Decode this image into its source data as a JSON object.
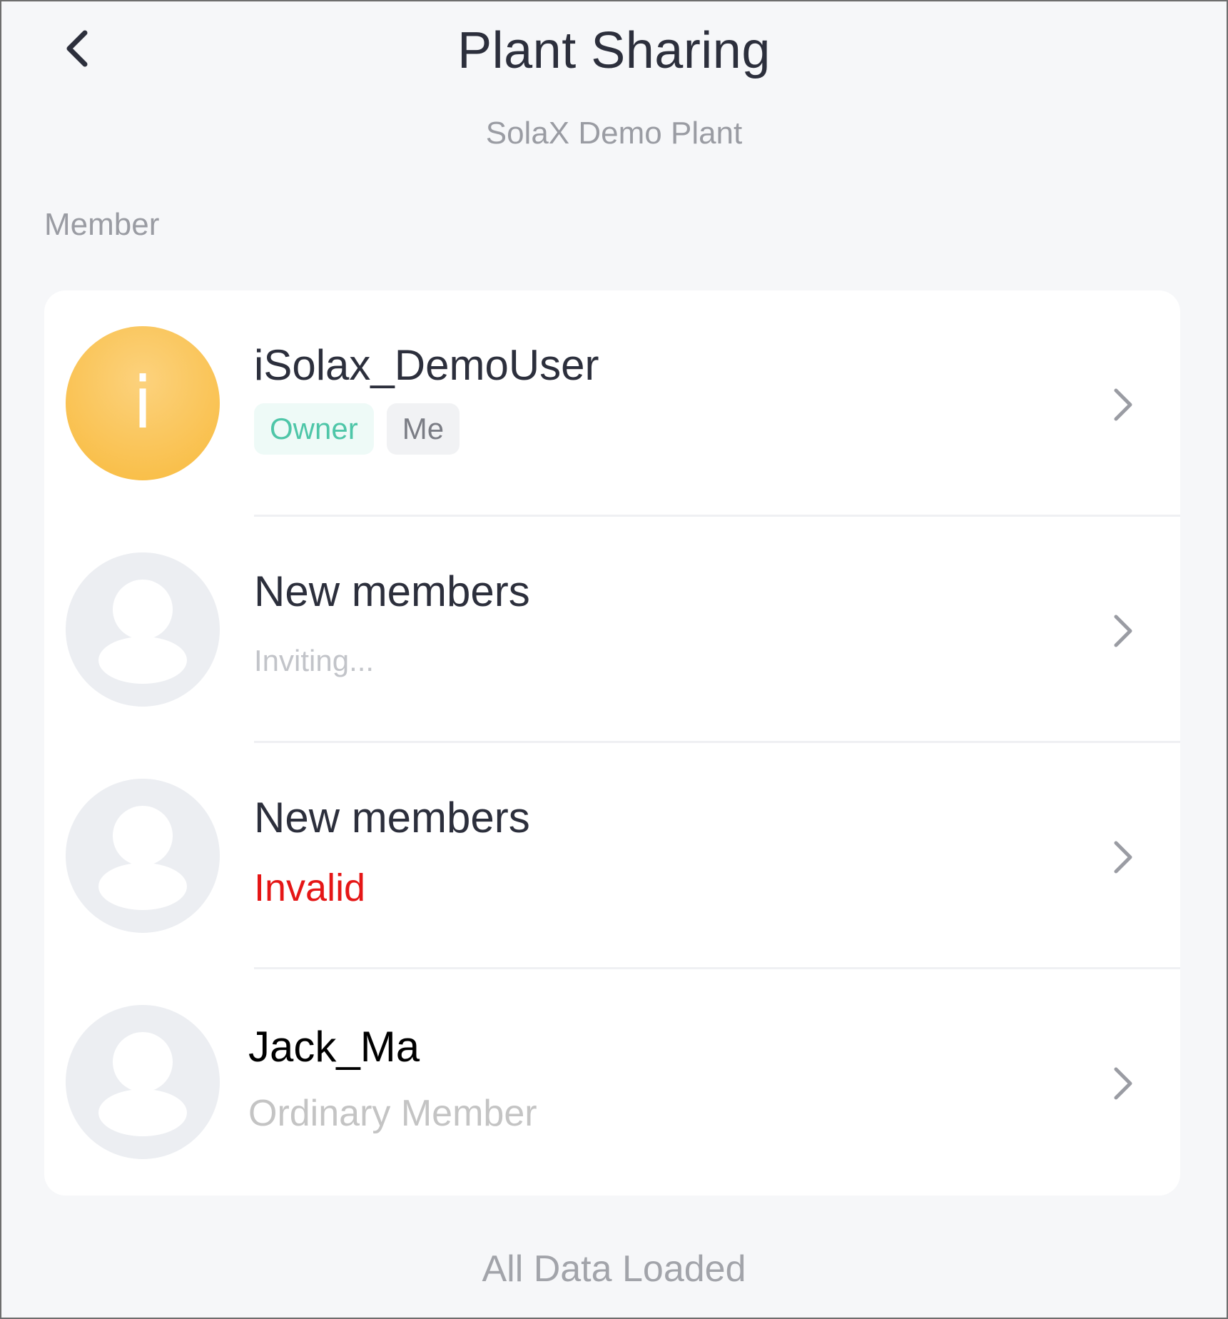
{
  "header": {
    "title": "Plant Sharing",
    "plant_name": "SolaX Demo Plant"
  },
  "section": {
    "label": "Member"
  },
  "members": [
    {
      "name": "iSolax_DemoUser",
      "avatar_letter": "i",
      "tags": [
        "Owner",
        "Me"
      ]
    },
    {
      "name": "New members",
      "status": "Inviting..."
    },
    {
      "name": "New members",
      "status": "Invalid"
    },
    {
      "name": "Jack_Ma",
      "status": "Ordinary Member"
    }
  ],
  "footer": {
    "status": "All Data Loaded"
  },
  "colors": {
    "owner_avatar": "#f8ba3c",
    "owner_tag_text": "#4ec6a8",
    "invalid_status": "#e51616",
    "background": "#f6f7f9"
  }
}
